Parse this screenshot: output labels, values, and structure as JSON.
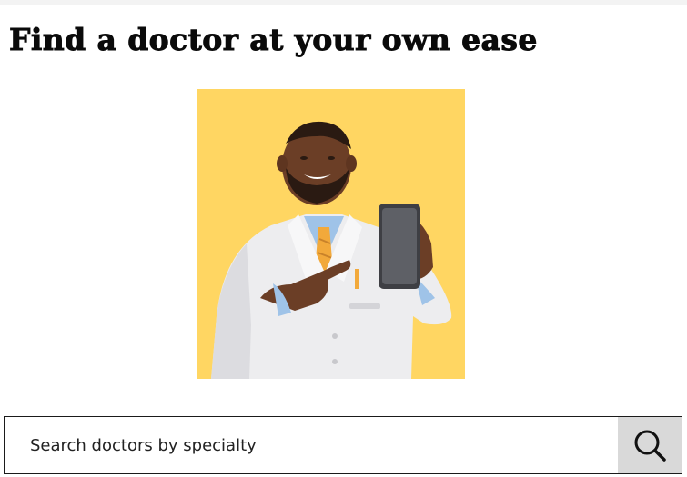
{
  "header": {
    "title": "Find a doctor at your own ease"
  },
  "hero": {
    "icon": "doctor-with-phone-illustration",
    "background_color": "#FFD662"
  },
  "search": {
    "placeholder": "Search doctors by specialty",
    "value": "",
    "button_icon": "search-icon",
    "button_color": "#D9D9D9"
  }
}
